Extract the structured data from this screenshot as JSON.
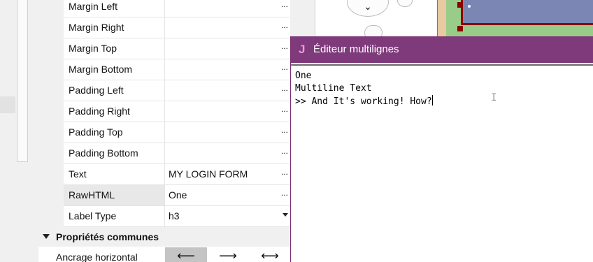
{
  "property_grid": {
    "rows": [
      {
        "name": "Margin Left",
        "value": "",
        "action": "..."
      },
      {
        "name": "Margin Right",
        "value": "",
        "action": "..."
      },
      {
        "name": "Margin Top",
        "value": "",
        "action": "..."
      },
      {
        "name": "Margin Bottom",
        "value": "",
        "action": "..."
      },
      {
        "name": "Padding Left",
        "value": "",
        "action": "..."
      },
      {
        "name": "Padding Right",
        "value": "",
        "action": "..."
      },
      {
        "name": "Padding Top",
        "value": "",
        "action": "..."
      },
      {
        "name": "Padding Bottom",
        "value": "",
        "action": "..."
      },
      {
        "name": "Text",
        "value": "MY LOGIN FORM",
        "action": "..."
      },
      {
        "name": "RawHTML",
        "value": "One",
        "action": "..."
      },
      {
        "name": "Label Type",
        "value": "h3",
        "action": ""
      }
    ],
    "category": {
      "label": "Propriétés communes"
    },
    "anchor": {
      "label": "Ancrage horizontal",
      "buttons": [
        "⟵",
        "⟶",
        "⟷"
      ]
    }
  },
  "dialog": {
    "title": "Éditeur multilignes",
    "icon_letter": "J",
    "lines": [
      "One",
      "Multiline Text",
      ">> And It's working! How?"
    ]
  },
  "colors": {
    "dialog_titlebar": "#7f3a7b",
    "selection_border": "#8b0000",
    "canvas_green": "#99cc88",
    "canvas_blue": "#7b86b5"
  }
}
